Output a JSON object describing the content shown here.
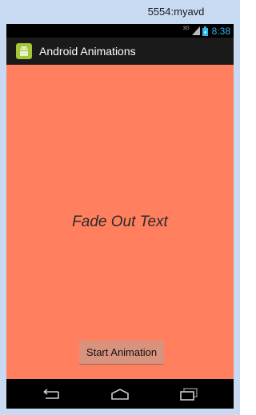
{
  "window": {
    "title": "5554:myavd"
  },
  "status_bar": {
    "network_label": "3G",
    "clock": "8:38"
  },
  "action_bar": {
    "app_title": "Android Animations",
    "icon": "android-app-icon"
  },
  "content": {
    "background_color": "#ff7f5f",
    "fade_text": "Fade Out Text",
    "start_button_label": "Start Animation"
  },
  "nav_bar": {
    "buttons": [
      "back-icon",
      "home-icon",
      "recent-apps-icon"
    ]
  }
}
